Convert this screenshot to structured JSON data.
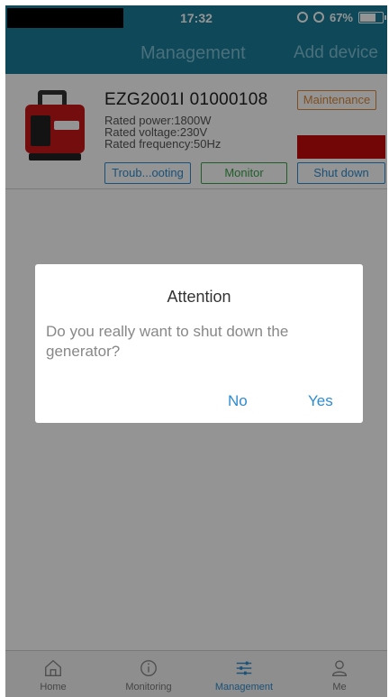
{
  "status_bar": {
    "time": "17:32",
    "battery": "67%"
  },
  "nav": {
    "title": "Management",
    "add_device": "Add device"
  },
  "device": {
    "name": "EZG2001I 01000108",
    "rated_power": "Rated power:1800W",
    "rated_voltage": "Rated voltage:230V",
    "rated_frequency": "Rated frequency:50Hz",
    "maintenance_label": "Maintenance",
    "troubleshooting_label": "Troub...ooting",
    "monitor_label": "Monitor",
    "shutdown_label": "Shut down",
    "accent_red": "#c40c0c"
  },
  "dialog": {
    "title": "Attention",
    "message": "Do you really want to shut down the generator?",
    "no_label": "No",
    "yes_label": "Yes"
  },
  "tabbar": {
    "items": [
      {
        "label": "Home",
        "icon": "home-icon"
      },
      {
        "label": "Monitoring",
        "icon": "info-icon"
      },
      {
        "label": "Management",
        "icon": "sliders-icon",
        "active": true
      },
      {
        "label": "Me",
        "icon": "person-icon"
      }
    ]
  },
  "colors": {
    "header": "#1a7d98",
    "link_blue": "#2e8ccf",
    "monitor_green": "#3aa34b",
    "maintenance_orange": "#d9893b"
  }
}
